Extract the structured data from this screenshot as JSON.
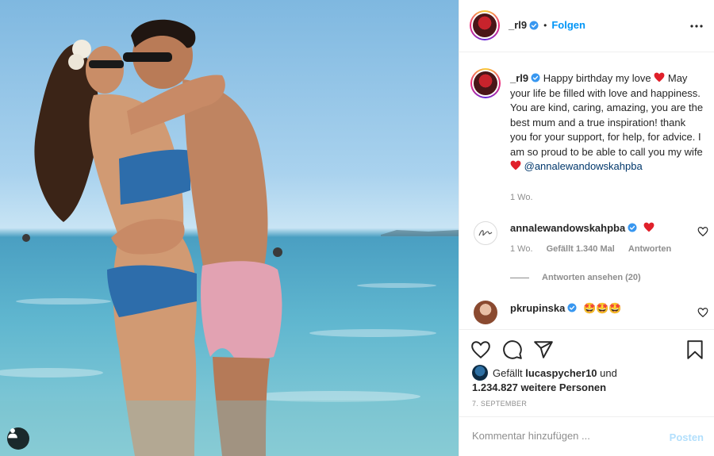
{
  "colors": {
    "accent": "#0095f6",
    "verified": "#3897f0",
    "heart": "#ed4956",
    "muted": "#8e8e8e"
  },
  "header": {
    "username": "_rl9",
    "separator": "•",
    "follow_label": "Folgen",
    "more_icon": "more-horizontal-icon"
  },
  "caption": {
    "username": "_rl9",
    "text": "Happy birthday my love",
    "body": "May your life be filled with love and happiness. You are kind, caring, amazing, you are the best mum and a true inspiration! thank you for your support, for help, for advice. I am so proud to be able to call you my wife",
    "mention": "@annalewandowskahpba",
    "time": "1 Wo."
  },
  "comments": [
    {
      "username": "annalewandowskahpba",
      "time": "1 Wo.",
      "likes": "Gefällt 1.340 Mal",
      "reply_label": "Antworten"
    },
    {
      "username": "pkrupinska",
      "emojis": "🤩🤩🤩"
    }
  ],
  "view_replies": "Antworten ansehen (20)",
  "likes": {
    "prefix": "Gefällt",
    "user": "lucaspycher10",
    "and": "und",
    "others": "1.234.827 weitere Personen"
  },
  "date": "7. September",
  "comment_box": {
    "placeholder": "Kommentar hinzufügen ...",
    "post_label": "Posten"
  }
}
